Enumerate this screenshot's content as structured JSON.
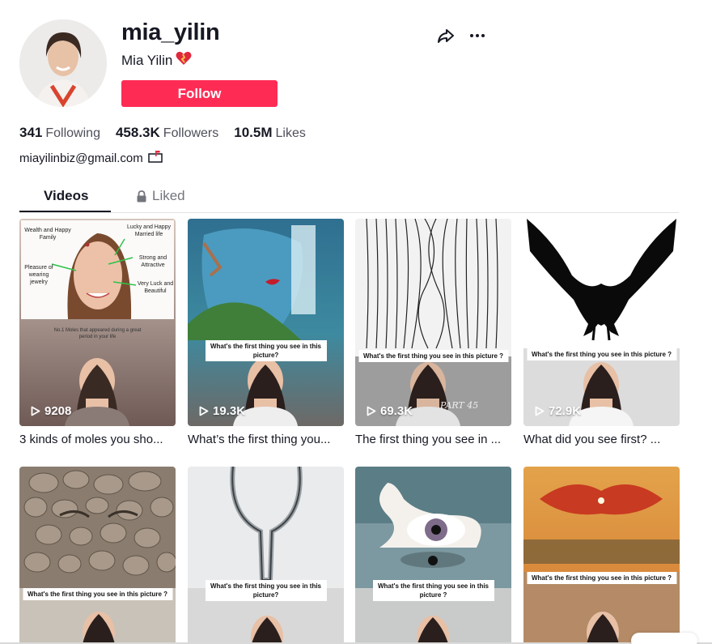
{
  "profile": {
    "username": "mia_yilin",
    "nickname": "Mia Yilin",
    "follow_label": "Follow",
    "bio_email": "miayilinbiz@gmail.com",
    "heart_icon": "mending-heart-emoji",
    "mail_icon": "mailbox-emoji"
  },
  "stats": {
    "following_count": "341",
    "following_label": "Following",
    "followers_count": "458.3K",
    "followers_label": "Followers",
    "likes_count": "10.5M",
    "likes_label": "Likes"
  },
  "tabs": {
    "videos": "Videos",
    "liked": "Liked"
  },
  "videos": [
    {
      "views": "9208",
      "caption": "3 kinds of moles you sho...",
      "overlay": [
        "Wealth and Happy Family",
        "Lucky and Happy Married life",
        "Strong and Attractive",
        "Pleasure of wearing jewelry",
        "Very Luck and Beautiful"
      ],
      "banner": "No.1 Moles that appeared during a great period in your life"
    },
    {
      "views": "19.3K",
      "caption": "What’s the first thing you...",
      "banner": "What's the first thing you see in this picture?"
    },
    {
      "views": "69.3K",
      "caption": "The first thing you see in ...",
      "banner": "What's the first thing you see in this picture ?",
      "watermark": "PART 45"
    },
    {
      "views": "72.9K",
      "caption": "What did you see first? ...",
      "banner": "What's the first thing you see in this picture ?"
    },
    {
      "views": "",
      "caption": "",
      "banner": "What's the first thing you see in this picture ?"
    },
    {
      "views": "",
      "caption": "",
      "banner": "What's the first thing you see in this picture?"
    },
    {
      "views": "",
      "caption": "",
      "banner": "What's the first thing you see in this picture ?"
    },
    {
      "views": "",
      "caption": "",
      "banner": "What's the first thing you see in this picture ?"
    }
  ],
  "colors": {
    "accent": "#fe2c55",
    "text_primary": "#161823",
    "text_secondary": "#4e505a"
  }
}
